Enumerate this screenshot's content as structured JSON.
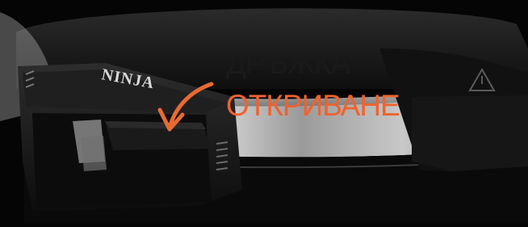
{
  "photo": {
    "brand_logo": "NINJA",
    "subject": "appliance lid with release handle"
  },
  "caption": {
    "line1": "ДРЪЖКА",
    "line2": "ОТКРИВАНЕ"
  },
  "colors": {
    "caption_primary": "#1a1a1a",
    "caption_accent": "#f0622d",
    "arrow": "#e86a33",
    "body_dark": "#0b0b0b",
    "steel": "#8e8e8e"
  },
  "icons": {
    "arrow": "curved-arrow-icon",
    "warning": "warning-triangle-icon"
  }
}
